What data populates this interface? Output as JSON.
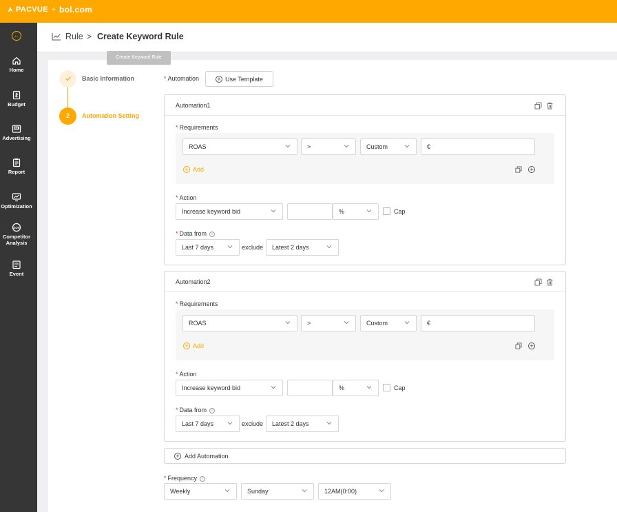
{
  "brand": {
    "logo_main": "PACVUE",
    "logo_sep": "+",
    "logo_partner": "bol.com"
  },
  "sidebar": {
    "items": [
      {
        "label": "Home",
        "icon": "home-icon"
      },
      {
        "label": "Budget",
        "icon": "budget-icon"
      },
      {
        "label": "Advertising",
        "icon": "advertising-icon"
      },
      {
        "label": "Report",
        "icon": "report-icon"
      },
      {
        "label": "Optimization",
        "icon": "optimization-icon"
      },
      {
        "label": "Competitor Analysis",
        "icon": "competitor-analysis-icon"
      },
      {
        "label": "Event",
        "icon": "event-icon"
      }
    ]
  },
  "breadcrumb": {
    "parent": "Rule",
    "separator": ">",
    "current": "Create Keyword Rule"
  },
  "tooltip": "Create Keyword Rule",
  "steps": [
    {
      "number": "✓",
      "label": "Basic Information"
    },
    {
      "number": "2",
      "label": "Automation Setting"
    }
  ],
  "form": {
    "automation_label": "Automation",
    "use_template_label": "Use Template",
    "add_automation_label": "Add Automation",
    "frequency_label": "Frequency",
    "frequency": {
      "period": "Weekly",
      "day": "Sunday",
      "time": "12AM(0:00)"
    }
  },
  "automations": [
    {
      "title": "Automation1",
      "requirements_label": "Requirements",
      "metric": "ROAS",
      "operator": ">",
      "value_type": "Custom",
      "value_unit": "€",
      "add_label": "Add",
      "action_label": "Action",
      "action": "Increase keyword bid",
      "action_value": "",
      "action_unit": "%",
      "cap_label": "Cap",
      "data_from_label": "Data from",
      "data_from": "Last 7 days",
      "exclude_label": "exclude",
      "exclude": "Latest 2 days"
    },
    {
      "title": "Automation2",
      "requirements_label": "Requirements",
      "metric": "ROAS",
      "operator": ">",
      "value_type": "Custom",
      "value_unit": "€",
      "add_label": "Add",
      "action_label": "Action",
      "action": "Increase keyword bid",
      "action_value": "",
      "action_unit": "%",
      "cap_label": "Cap",
      "data_from_label": "Data from",
      "data_from": "Last 7 days",
      "exclude_label": "exclude",
      "exclude": "Latest 2 days"
    }
  ],
  "colors": {
    "brand": "#ffa800",
    "sidebar": "#363636",
    "required": "#e0342a"
  }
}
